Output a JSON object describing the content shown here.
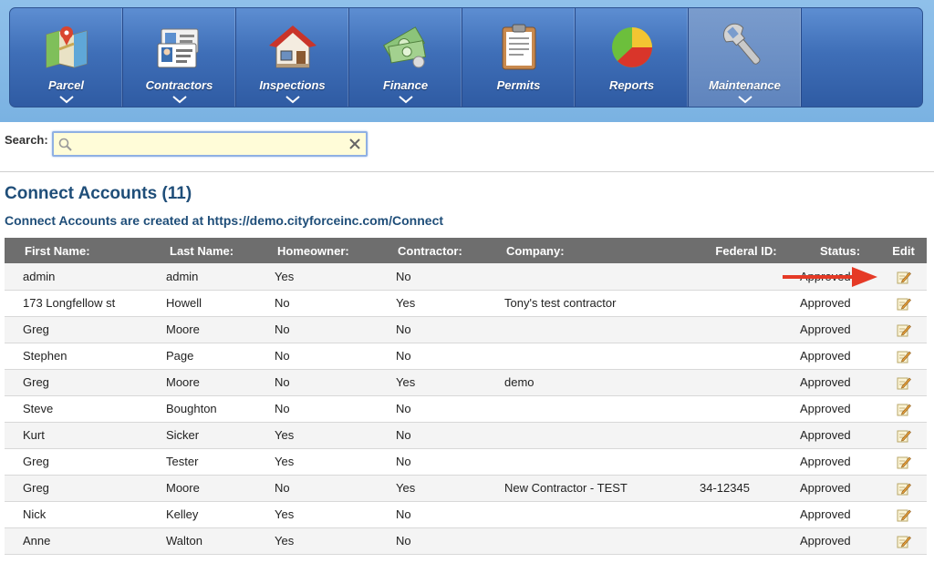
{
  "nav": {
    "items": [
      {
        "label": "Parcel",
        "icon": "map-icon"
      },
      {
        "label": "Contractors",
        "icon": "id-card-icon"
      },
      {
        "label": "Inspections",
        "icon": "house-icon"
      },
      {
        "label": "Finance",
        "icon": "money-icon"
      },
      {
        "label": "Permits",
        "icon": "clipboard-icon"
      },
      {
        "label": "Reports",
        "icon": "pie-chart-icon"
      },
      {
        "label": "Maintenance",
        "icon": "wrench-icon",
        "active": true
      }
    ]
  },
  "search": {
    "label": "Search:",
    "value": "",
    "placeholder": ""
  },
  "page": {
    "title": "Connect Accounts (11)",
    "subtitle": "Connect Accounts are created at https://demo.cityforceinc.com/Connect"
  },
  "table": {
    "headers": {
      "first": "First Name:",
      "last": "Last Name:",
      "homeowner": "Homeowner:",
      "contractor": "Contractor:",
      "company": "Company:",
      "federal_id": "Federal ID:",
      "status": "Status:",
      "edit": "Edit"
    },
    "rows": [
      {
        "first": "admin",
        "last": "admin",
        "homeowner": "Yes",
        "contractor": "No",
        "company": "",
        "federal_id": "",
        "status": "Approved"
      },
      {
        "first": "173 Longfellow st",
        "last": "Howell",
        "homeowner": "No",
        "contractor": "Yes",
        "company": "Tony's test contractor",
        "federal_id": "",
        "status": "Approved"
      },
      {
        "first": "Greg",
        "last": "Moore",
        "homeowner": "No",
        "contractor": "No",
        "company": "",
        "federal_id": "",
        "status": "Approved"
      },
      {
        "first": "Stephen",
        "last": "Page",
        "homeowner": "No",
        "contractor": "No",
        "company": "",
        "federal_id": "",
        "status": "Approved"
      },
      {
        "first": "Greg",
        "last": "Moore",
        "homeowner": "No",
        "contractor": "Yes",
        "company": "demo",
        "federal_id": "",
        "status": "Approved"
      },
      {
        "first": "Steve",
        "last": "Boughton",
        "homeowner": "No",
        "contractor": "No",
        "company": "",
        "federal_id": "",
        "status": "Approved"
      },
      {
        "first": "Kurt",
        "last": "Sicker",
        "homeowner": "Yes",
        "contractor": "No",
        "company": "",
        "federal_id": "",
        "status": "Approved"
      },
      {
        "first": "Greg",
        "last": "Tester",
        "homeowner": "Yes",
        "contractor": "No",
        "company": "",
        "federal_id": "",
        "status": "Approved"
      },
      {
        "first": "Greg",
        "last": "Moore",
        "homeowner": "No",
        "contractor": "Yes",
        "company": "New Contractor - TEST",
        "federal_id": "34-12345",
        "status": "Approved"
      },
      {
        "first": "Nick",
        "last": "Kelley",
        "homeowner": "Yes",
        "contractor": "No",
        "company": "",
        "federal_id": "",
        "status": "Approved"
      },
      {
        "first": "Anne",
        "last": "Walton",
        "homeowner": "Yes",
        "contractor": "No",
        "company": "",
        "federal_id": "",
        "status": "Approved"
      }
    ]
  },
  "colors": {
    "nav_blue": "#3f6fb8",
    "title_blue": "#1f4e79",
    "header_gray": "#6e6e6e",
    "search_bg": "#fffcd8",
    "annotation_arrow": "#e53a26"
  }
}
